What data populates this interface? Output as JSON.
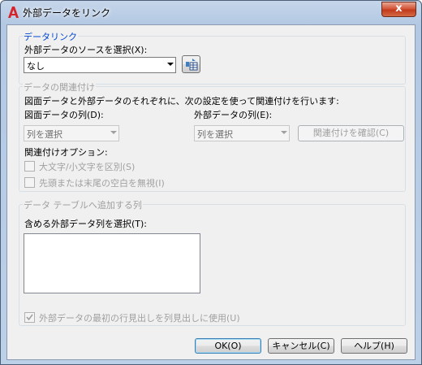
{
  "window": {
    "title": "外部データをリンク",
    "close_glyph": "x"
  },
  "data_link": {
    "group_title": "データリンク",
    "source_label": "外部データのソースを選択(X):",
    "source_value": "なし"
  },
  "association": {
    "group_title": "データの関連付け",
    "description": "図面データと外部データのそれぞれに、次の設定を使って関連付けを行います:",
    "drawing_column_label": "図面データの列(D):",
    "drawing_column_value": "列を選択",
    "external_column_label": "外部データの列(E):",
    "external_column_value": "列を選択",
    "verify_button": "関連付けを確認(C)",
    "options_label": "関連付けオプション:",
    "case_sensitive_label": "大文字/小文字を区別(S)",
    "ignore_spaces_label": "先頭または末尾の空白を無視(I)"
  },
  "columns": {
    "group_title": "データ テーブルへ追加する列",
    "include_label": "含める外部データ列を選択(T):",
    "first_row_header_label": "外部データの最初の行見出しを列見出しに使用(U)",
    "first_row_header_checked": true
  },
  "buttons": {
    "ok": "OK(O)",
    "cancel": "キャンセル(C)",
    "help": "ヘルプ(H)"
  }
}
